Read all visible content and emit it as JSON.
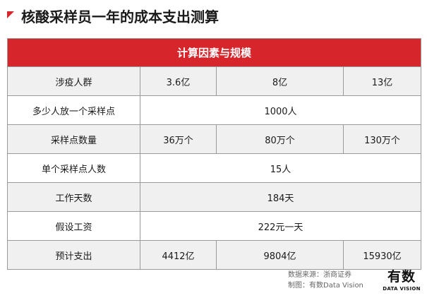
{
  "title": "核酸采样员一年的成本支出测算",
  "table": {
    "header": "计算因素与规模",
    "rows": [
      {
        "label": "涉疫人群",
        "cells": [
          "3.6亿",
          "8亿",
          "13亿"
        ]
      },
      {
        "label": "多少人放一个采样点",
        "merged": "1000人"
      },
      {
        "label": "采样点数量",
        "cells": [
          "36万个",
          "80万个",
          "130万个"
        ]
      },
      {
        "label": "单个采样点人数",
        "merged": "15人"
      },
      {
        "label": "工作天数",
        "merged": "184天"
      },
      {
        "label": "假设工资",
        "merged": "222元一天"
      },
      {
        "label": "预计支出",
        "cells": [
          "4412亿",
          "9804亿",
          "15930亿"
        ]
      }
    ]
  },
  "footer": {
    "source": "数据来源：浙商证券",
    "credit": "制图：有数Data Vision"
  },
  "logo": {
    "cn": "有数",
    "en": "DATA VISION"
  },
  "colors": {
    "accent": "#d6252b",
    "stripe": "#f0f0f0",
    "border": "#9a9a9a"
  }
}
